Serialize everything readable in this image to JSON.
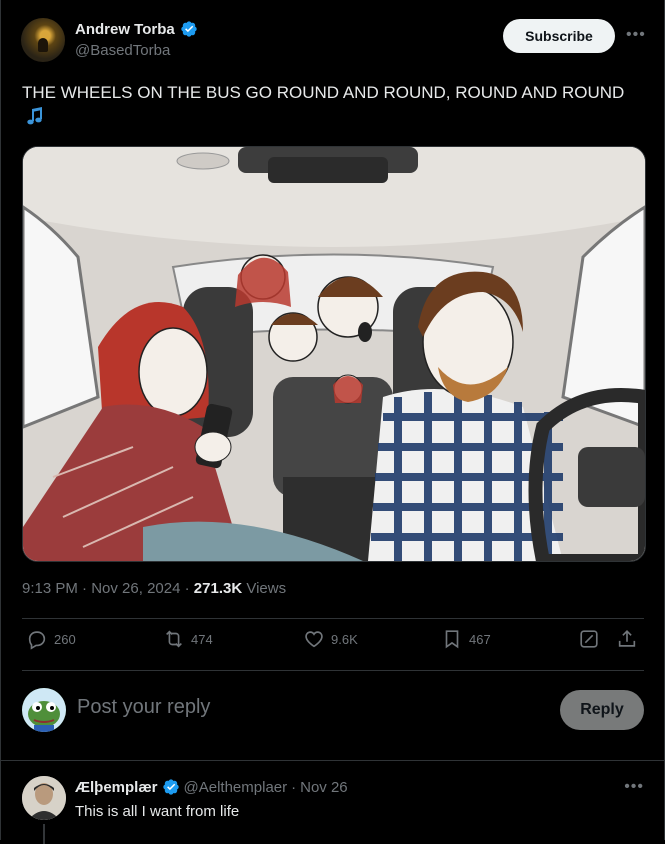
{
  "author": {
    "display_name": "Andrew Torba",
    "handle": "@BasedTorba",
    "verified": true,
    "verified_color": "#1d9bf0"
  },
  "header": {
    "subscribe_label": "Subscribe",
    "more_icon": "more-icon"
  },
  "tweet": {
    "text": "THE WHEELS ON THE BUS GO ROUND AND ROUND, ROUND AND ROUND",
    "emoji": "music-notes-icon",
    "image_icon": "family-car-meme-image"
  },
  "meta": {
    "time": "9:13 PM",
    "sep1": "·",
    "date": "Nov 26, 2024",
    "sep2": "·",
    "views_count": "271.3K",
    "views_label": "Views"
  },
  "actions": {
    "replies": "260",
    "reposts": "474",
    "likes": "9.6K",
    "bookmarks": "467"
  },
  "reply_bar": {
    "placeholder": "Post your reply",
    "button_label": "Reply"
  },
  "comment": {
    "display_name": "Ælþemplær",
    "handle": "@Aelthemplaer",
    "sep": "·",
    "date": "Nov 26",
    "text": "This is all I want from life"
  },
  "colors": {
    "background": "#000000",
    "text": "#e7e9ea",
    "secondary": "#71767b",
    "border": "#2f3336",
    "accent": "#1d9bf0"
  }
}
